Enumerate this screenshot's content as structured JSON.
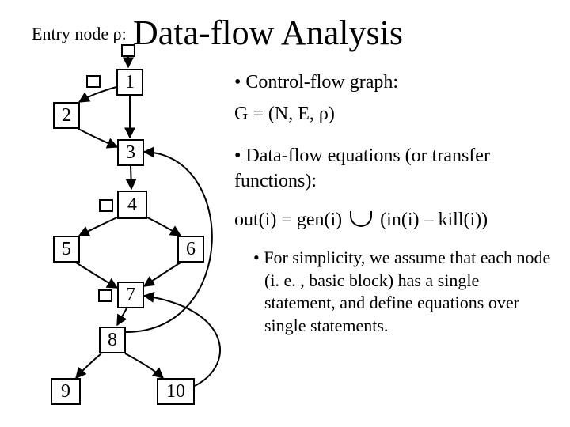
{
  "title": "Data-flow Analysis",
  "entry_label": "Entry node ρ:",
  "nodes": {
    "n1": "1",
    "n2": "2",
    "n3": "3",
    "n4": "4",
    "n5": "5",
    "n6": "6",
    "n7": "7",
    "n8": "8",
    "n9": "9",
    "n10": "10"
  },
  "bullets": {
    "b1": "• Control-flow graph:",
    "graph_eq": "G = (N, E, ρ)",
    "b2": "• Data-flow equations (or transfer functions):",
    "out_eq_left": "out(i) = gen(i) ",
    "out_eq_right": " (in(i) – kill(i))",
    "b3": "• For simplicity, we assume that each node (i. e. , basic block) has a single statement, and define equations over single statements."
  },
  "graph": {
    "entry": "ρ",
    "nodes": [
      "1",
      "2",
      "3",
      "4",
      "5",
      "6",
      "7",
      "8",
      "9",
      "10"
    ],
    "edges": [
      [
        "ρ",
        "1"
      ],
      [
        "1",
        "2"
      ],
      [
        "1",
        "3"
      ],
      [
        "2",
        "3"
      ],
      [
        "3",
        "4"
      ],
      [
        "4",
        "5"
      ],
      [
        "4",
        "6"
      ],
      [
        "5",
        "7"
      ],
      [
        "6",
        "7"
      ],
      [
        "7",
        "8"
      ],
      [
        "8",
        "9"
      ],
      [
        "8",
        "10"
      ],
      [
        "8",
        "3"
      ],
      [
        "10",
        "7"
      ]
    ]
  },
  "chart_data": {
    "type": "diagram",
    "description": "Control-flow graph for data-flow analysis",
    "nodes": [
      "ρ",
      "1",
      "2",
      "3",
      "4",
      "5",
      "6",
      "7",
      "8",
      "9",
      "10"
    ],
    "edges": [
      {
        "from": "ρ",
        "to": "1"
      },
      {
        "from": "1",
        "to": "2"
      },
      {
        "from": "1",
        "to": "3"
      },
      {
        "from": "2",
        "to": "3"
      },
      {
        "from": "3",
        "to": "4"
      },
      {
        "from": "4",
        "to": "5"
      },
      {
        "from": "4",
        "to": "6"
      },
      {
        "from": "5",
        "to": "7"
      },
      {
        "from": "6",
        "to": "7"
      },
      {
        "from": "7",
        "to": "8"
      },
      {
        "from": "8",
        "to": "9"
      },
      {
        "from": "8",
        "to": "10"
      },
      {
        "from": "8",
        "to": "3",
        "back_edge": true
      },
      {
        "from": "10",
        "to": "7",
        "back_edge": true
      }
    ]
  }
}
